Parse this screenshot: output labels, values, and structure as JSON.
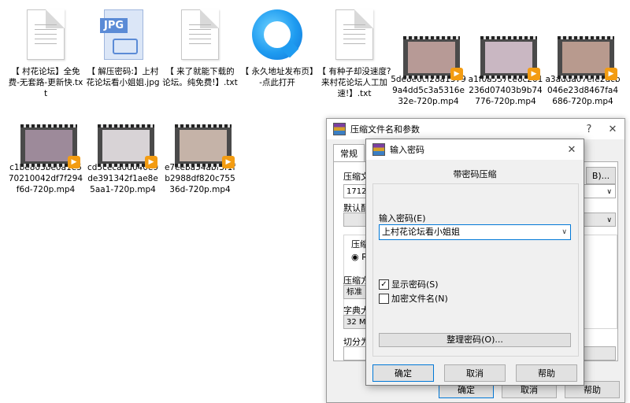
{
  "desktop": {
    "files": [
      {
        "label": "【 村花论坛】全免费-无套路-更新快.txt",
        "type": "txt"
      },
      {
        "label": "【 解压密码:】上村花论坛看小姐姐.jpg",
        "type": "jpg",
        "tag": "JPG"
      },
      {
        "label": "【 来了就能下载的论坛。纯免费!】.txt",
        "type": "txt"
      },
      {
        "label": "【 永久地址发布页】-点此打开",
        "type": "browser"
      },
      {
        "label": "【 有种子却没速度?来村花论坛人工加速!】.txt",
        "type": "txt"
      },
      {
        "label": "5de8e6cf28a13799a4dd5c3a5316e32e-720p.mp4",
        "type": "video"
      },
      {
        "label": "a1f0a537ce6c201236d07403b9b74776-720p.mp4",
        "type": "video"
      },
      {
        "label": "a3adda07efe2dcb046e23d8467fa4686-720p.mp4",
        "type": "video"
      },
      {
        "label": "c1be803be0a1e570210042df7f294f6d-720p.mp4",
        "type": "video"
      },
      {
        "label": "cd5ceca0d640e9de391342f1ae8e5aa1-720p.mp4",
        "type": "video"
      },
      {
        "label": "e7eeba54abf3f1fb2988df820c75536d-720p.mp4",
        "type": "video"
      }
    ]
  },
  "archive_dialog": {
    "title": "压缩文件名和参数",
    "help_btn": "?",
    "close_btn": "✕",
    "tab_general": "常规",
    "archive_name_label": "压缩文",
    "archive_name_value": "1712.r",
    "browse_btn": "B)...",
    "default_label": "默认配",
    "format_label": "压缩文",
    "format_rar": "RA",
    "method_label": "压缩方",
    "method_value": "标准",
    "dict_label": "字典大",
    "dict_value": "32 MB",
    "split_label": "切分为",
    "ok": "确定",
    "cancel": "取消",
    "help": "帮助"
  },
  "password_dialog": {
    "title": "输入密码",
    "close_btn": "✕",
    "subtitle": "带密码压缩",
    "password_label": "输入密码(E)",
    "password_value": "上村花论坛看小姐姐",
    "show_password": "显示密码(S)",
    "show_password_checked": true,
    "encrypt_names": "加密文件名(N)",
    "encrypt_names_checked": false,
    "organize_btn": "整理密码(O)...",
    "ok": "确定",
    "cancel": "取消",
    "help": "帮助"
  },
  "colors": {
    "accent": "#0078d7",
    "play_badge": "#f39c12"
  }
}
